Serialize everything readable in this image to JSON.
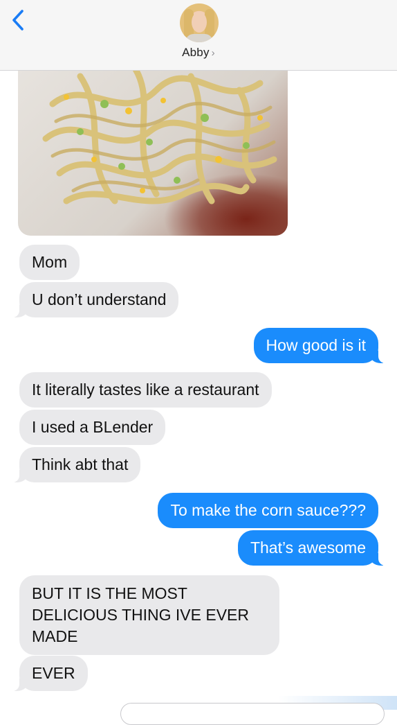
{
  "header": {
    "contact_name": "Abby",
    "chevron": "›"
  },
  "attachment": {
    "icon": "pasta-photo"
  },
  "messages": [
    {
      "text": "Mom",
      "dir": "in"
    },
    {
      "text": "U don’t understand",
      "dir": "in"
    },
    {
      "text": "How good is it",
      "dir": "out"
    },
    {
      "text": "It literally tastes like a restaurant",
      "dir": "in"
    },
    {
      "text": "I used a BLender",
      "dir": "in"
    },
    {
      "text": "Think abt that",
      "dir": "in"
    },
    {
      "text": "To make the corn sauce???",
      "dir": "out"
    },
    {
      "text": "That’s awesome",
      "dir": "out"
    },
    {
      "text": "BUT IT IS THE MOST DELICIOUS THING IVE EVER MADE",
      "dir": "in"
    },
    {
      "text": "EVER",
      "dir": "in"
    }
  ],
  "colors": {
    "incoming": "#e9e9eb",
    "outgoing": "#1a8cfc",
    "accent": "#1a7cf5"
  }
}
